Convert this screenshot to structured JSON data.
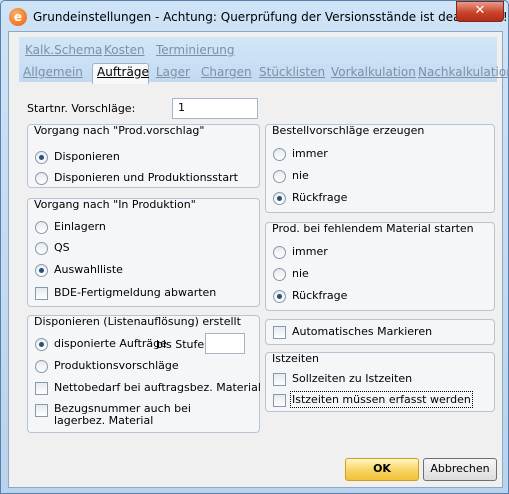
{
  "window": {
    "title": "Grundeinstellungen - Achtung: Querprüfung der Versionsstände ist deaktiviert!",
    "icon": "e",
    "close_glyph": "✕"
  },
  "tabs_row1": [
    {
      "label": "Kalk.Schema"
    },
    {
      "label": "Kosten"
    },
    {
      "label": "Terminierung"
    }
  ],
  "tabs_row2": [
    {
      "label": "Allgemein"
    },
    {
      "label": "Aufträge",
      "active": true
    },
    {
      "label": "Lager"
    },
    {
      "label": "Chargen"
    },
    {
      "label": "Stücklisten"
    },
    {
      "label": "Vorkalkulation"
    },
    {
      "label": "Nachkalkulation"
    }
  ],
  "startnr": {
    "label": "Startnr. Vorschläge:",
    "value": "1"
  },
  "group_prod_vorschlag": {
    "title": "Vorgang nach \"Prod.vorschlag\"",
    "options": [
      {
        "label": "Disponieren",
        "checked": true
      },
      {
        "label": "Disponieren und Produktionsstart",
        "checked": false
      }
    ]
  },
  "group_in_produktion": {
    "title": "Vorgang nach \"In Produktion\"",
    "options": [
      {
        "label": "Einlagern",
        "checked": false
      },
      {
        "label": "QS",
        "checked": false
      },
      {
        "label": "Auswahlliste",
        "checked": true
      }
    ],
    "checkbox": {
      "label": "BDE-Fertigmeldung abwarten",
      "checked": false
    }
  },
  "group_disponieren": {
    "title": "Disponieren (Listenauflösung) erstellt",
    "options": [
      {
        "label": "disponierte Aufträge",
        "checked": true
      },
      {
        "label": "Produktionsvorschläge",
        "checked": false
      }
    ],
    "stufe_label": "bis Stufe:",
    "stufe_value": "",
    "checkboxes": [
      {
        "label": "Nettobedarf bei auftragsbez. Material",
        "checked": false
      },
      {
        "label": "Bezugsnummer auch bei lagerbez. Material",
        "checked": false
      }
    ]
  },
  "group_bestellvorschlaege": {
    "title": "Bestellvorschläge erzeugen",
    "options": [
      {
        "label": "immer",
        "checked": false
      },
      {
        "label": "nie",
        "checked": false
      },
      {
        "label": "Rückfrage",
        "checked": true
      }
    ]
  },
  "group_fehlendes_material": {
    "title": "Prod. bei fehlendem Material starten",
    "options": [
      {
        "label": "immer",
        "checked": false
      },
      {
        "label": "nie",
        "checked": false
      },
      {
        "label": "Rückfrage",
        "checked": true
      }
    ]
  },
  "auto_markieren": {
    "label": "Automatisches Markieren",
    "checked": false
  },
  "group_istzeiten": {
    "title": "Istzeiten",
    "checkboxes": [
      {
        "label": "Sollzeiten zu Istzeiten",
        "checked": false
      },
      {
        "label": "Istzeiten müssen erfasst werden",
        "checked": false
      }
    ]
  },
  "buttons": {
    "ok": "OK",
    "cancel": "Abbrechen"
  }
}
